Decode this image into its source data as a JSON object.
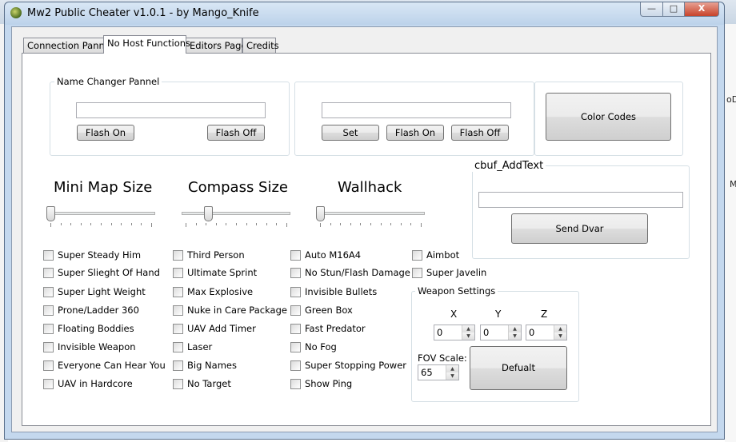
{
  "background": {
    "fragment_1": "oD",
    "fragment_2": "M"
  },
  "window": {
    "title": "Mw2 Public Cheater v1.0.1 - by Mango_Knife",
    "minimize_glyph": "—",
    "maximize_glyph": "□",
    "close_glyph": "X"
  },
  "tabs": [
    {
      "label": "Connection Pannel"
    },
    {
      "label": "No Host Functions"
    },
    {
      "label": "Editors Page"
    },
    {
      "label": "Credits"
    }
  ],
  "name_changer": {
    "title": "Name Changer Pannel",
    "input_value": "",
    "flash_on_label": "Flash On",
    "flash_off_label": "Flash Off"
  },
  "name_set": {
    "input_value": "",
    "set_label": "Set",
    "flash_on_label": "Flash On",
    "flash_off_label": "Flash Off"
  },
  "color_codes_label": "Color Codes",
  "cbuf": {
    "title": "cbuf_AddText",
    "input_value": "",
    "send_label": "Send Dvar"
  },
  "sliders": {
    "minimap": {
      "label": "Mini Map Size",
      "level": 0
    },
    "compass": {
      "label": "Compass Size",
      "level": 0.22
    },
    "wallhack": {
      "label": "Wallhack",
      "level": 0
    }
  },
  "checkboxes": {
    "col1": [
      "Super Steady Him",
      "Super Slieght Of Hand",
      "Super Light Weight",
      "Prone/Ladder 360",
      "Floating Boddies",
      "Invisible Weapon",
      "Everyone Can Hear You",
      "UAV in Hardcore"
    ],
    "col2": [
      "Third Person",
      "Ultimate Sprint",
      "Max Explosive",
      "Nuke in Care Package",
      "UAV Add Timer",
      "Laser",
      "Big Names",
      "No Target"
    ],
    "col3": [
      "Auto M16A4",
      "No Stun/Flash Damage",
      "Invisible Bullets",
      "Green Box",
      "Fast Predator",
      "No Fog",
      "Super Stopping Power",
      "Show Ping"
    ],
    "col4": [
      "Aimbot",
      "Super Javelin"
    ]
  },
  "weapon_settings": {
    "title": "Weapon Settings",
    "x_label": "X",
    "y_label": "Y",
    "z_label": "Z",
    "x_value": "0",
    "y_value": "0",
    "z_value": "0",
    "fov_label": "FOV Scale:",
    "fov_value": "65",
    "default_label": "Defualt"
  },
  "icons": {
    "app": "mw2-app-icon",
    "spin_up": "▲",
    "spin_down": "▼"
  }
}
